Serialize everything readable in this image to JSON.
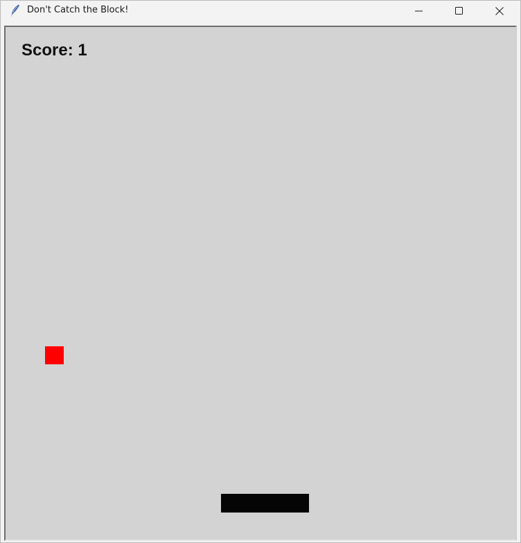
{
  "window": {
    "title": "Don't Catch the Block!",
    "app_icon": "feather-icon",
    "controls": {
      "minimize_icon": "minimize-icon",
      "maximize_icon": "maximize-icon",
      "close_icon": "close-icon"
    }
  },
  "game": {
    "score_text": "Score: 1",
    "colors": {
      "background": "#d3d3d3",
      "falling_block": "#ff0000",
      "paddle": "#050505",
      "score_text": "#111111"
    }
  }
}
